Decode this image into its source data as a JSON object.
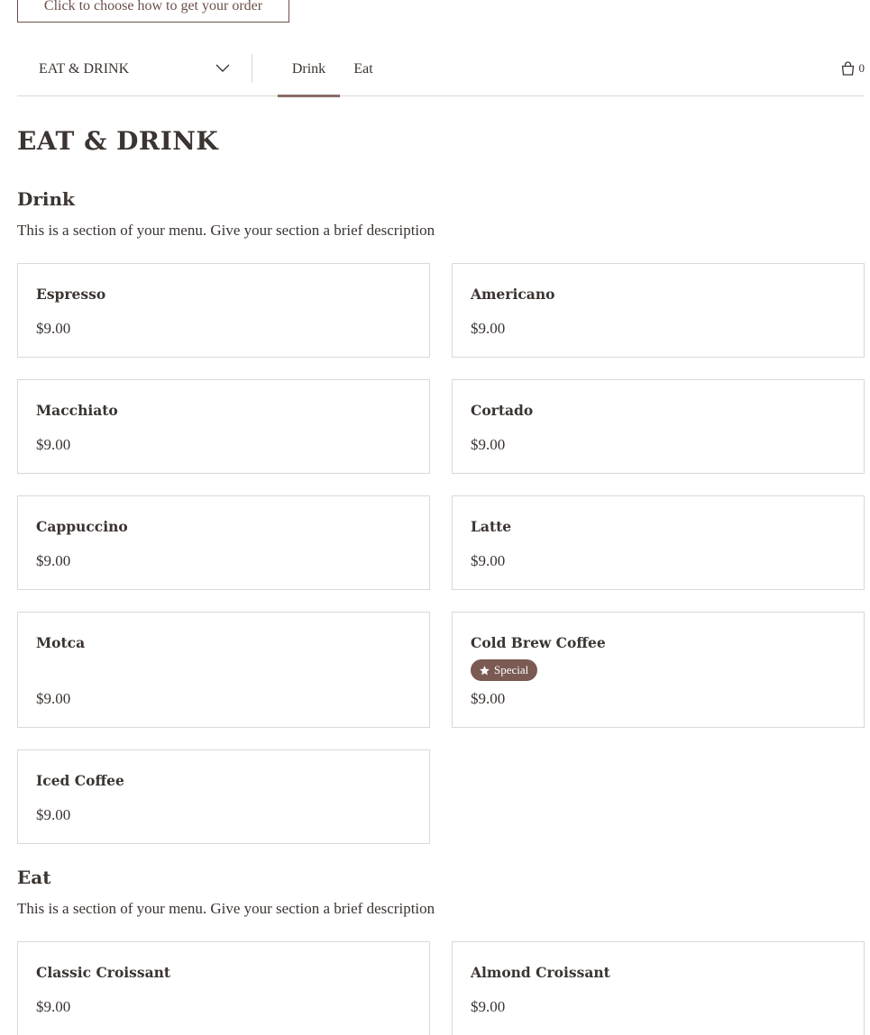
{
  "order_button": {
    "label": "Click to choose how to get your order"
  },
  "nav": {
    "menu_select": "EAT & DRINK",
    "tabs": [
      {
        "label": "Drink",
        "active": true
      },
      {
        "label": "Eat",
        "active": false
      }
    ],
    "cart_icon": "shopping-bag-icon",
    "cart_count": "0"
  },
  "menu": {
    "title": "EAT & DRINK",
    "sections": [
      {
        "title": "Drink",
        "description": "This is a section of your menu. Give your section a brief description",
        "items": [
          {
            "name": "Espresso",
            "price": "$9.00"
          },
          {
            "name": "Americano",
            "price": "$9.00"
          },
          {
            "name": "Macchiato",
            "price": "$9.00"
          },
          {
            "name": "Cortado",
            "price": "$9.00"
          },
          {
            "name": "Cappuccino",
            "price": "$9.00"
          },
          {
            "name": "Latte",
            "price": "$9.00"
          },
          {
            "name": "Motca",
            "price": "$9.00"
          },
          {
            "name": "Cold Brew Coffee",
            "price": "$9.00",
            "badge": "Special",
            "badge_icon": "star-icon"
          },
          {
            "name": "Iced Coffee",
            "price": "$9.00"
          }
        ]
      },
      {
        "title": "Eat",
        "description": "This is a section of your menu. Give your section a brief description",
        "items": [
          {
            "name": "Classic Croissant",
            "price": "$9.00"
          },
          {
            "name": "Almond Croissant",
            "price": "$9.00"
          }
        ]
      }
    ]
  },
  "colors": {
    "accent": "#7a5a53",
    "text": "#3b3431",
    "border": "#dcd8d6",
    "tab_underline": "#8a6e67"
  }
}
